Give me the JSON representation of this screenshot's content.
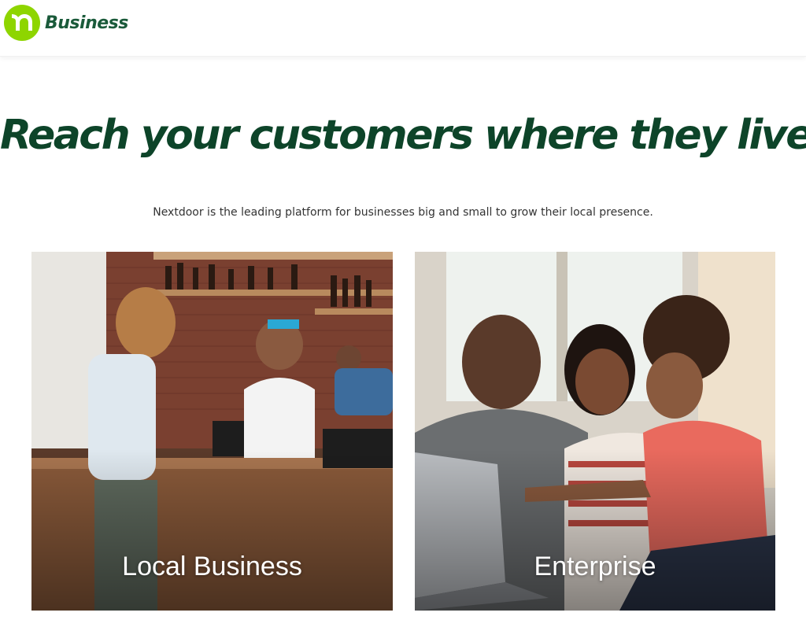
{
  "header": {
    "logo_text": "Business",
    "logo_icon": "nextdoor-n-icon",
    "brand_color": "#8ed500"
  },
  "hero": {
    "headline": "Reach your customers where they live.",
    "subheadline": "Nextdoor is the leading platform for businesses big and small to grow their local presence.",
    "headline_color": "#0d4429"
  },
  "cards": [
    {
      "label": "Local Business",
      "image": "cafe-counter-photo"
    },
    {
      "label": "Enterprise",
      "image": "family-laptop-photo"
    }
  ]
}
